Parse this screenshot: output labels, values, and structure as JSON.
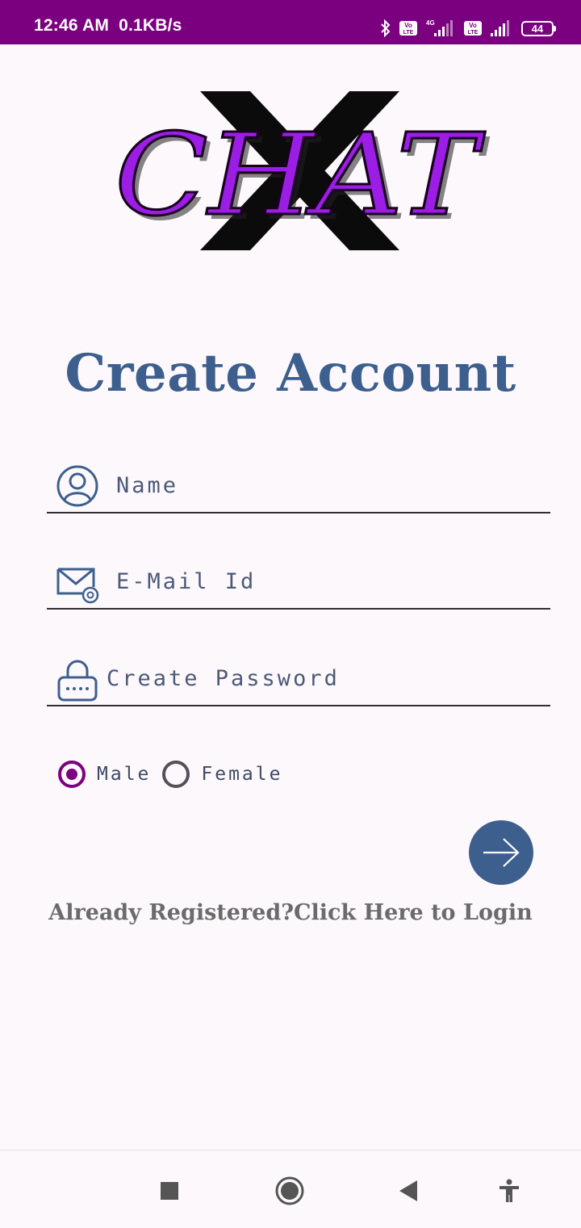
{
  "status_bar": {
    "time": "12:46 AM",
    "speed": "0.1KB/s",
    "network_label": "4G",
    "volte_label": "Vo LTE",
    "battery": "44"
  },
  "logo": {
    "text": "CHAT",
    "overlay": "X",
    "color": "#9c1ee6"
  },
  "title": "Create Account",
  "form": {
    "name_placeholder": "Name",
    "email_placeholder": "E-Mail Id",
    "password_placeholder": "Create Password",
    "gender": {
      "options": [
        "Male",
        "Female"
      ],
      "selected": "Male"
    }
  },
  "login_link": "Already Registered?Click Here to Login",
  "colors": {
    "status_bar": "#7b0080",
    "accent": "#3d5f8d",
    "radio_selected": "#7b0080"
  },
  "icons": {
    "name": "user-circle-icon",
    "email": "mail-at-icon",
    "password": "lock-icon",
    "submit": "arrow-right-icon"
  },
  "navbar": [
    "recents-square-icon",
    "home-circle-icon",
    "back-triangle-icon",
    "accessibility-icon"
  ]
}
